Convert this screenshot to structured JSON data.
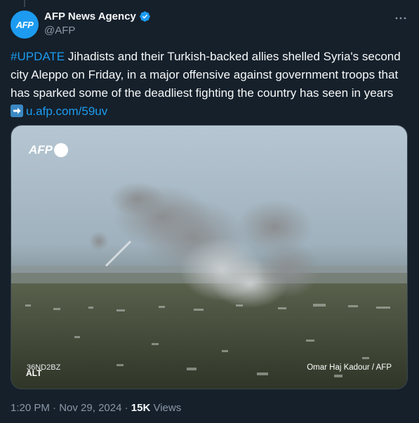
{
  "author": {
    "name": "AFP News Agency",
    "handle": "@AFP",
    "avatar_text": "AFP",
    "verified_icon": "verified-badge-icon"
  },
  "more_icon": "more-horizontal-icon",
  "tweet": {
    "hashtag": "#UPDATE",
    "text": " Jihadists and their Turkish-backed allies shelled Syria's second city Aleppo on Friday, in a major offensive against government troops that has sparked some of the deadliest fighting the country has seen in years ",
    "emoji": "right-arrow-emoji",
    "link": "u.afp.com/59uv"
  },
  "media": {
    "watermark": "AFP",
    "code": "36ND2BZ",
    "alt_label": "ALT",
    "credit": "Omar Haj Kadour / AFP"
  },
  "meta": {
    "time": "1:20 PM",
    "separator1": " · ",
    "date": "Nov 29, 2024",
    "separator2": " · ",
    "views_count": "15K",
    "views_label": " Views"
  },
  "colors": {
    "background": "#15202b",
    "accent": "#1d9bf0",
    "secondary_text": "#8b98a5"
  }
}
